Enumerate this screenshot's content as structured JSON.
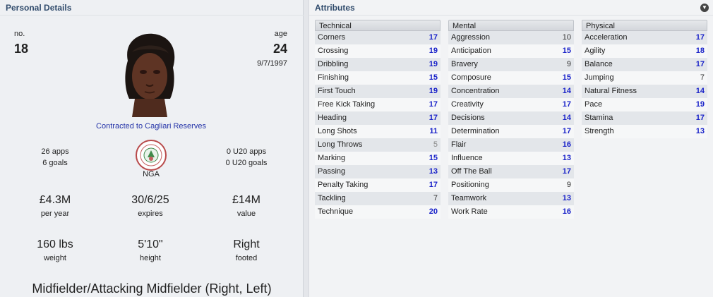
{
  "left": {
    "title": "Personal Details",
    "number_label": "no.",
    "number": "18",
    "age_label": "age",
    "age": "24",
    "dob": "9/7/1997",
    "contract": "Contracted to Cagliari Reserves",
    "apps": "26 apps",
    "goals": "6 goals",
    "u20_apps": "0 U20 apps",
    "u20_goals": "0 U20 goals",
    "nation": "NGA",
    "wage": "£4.3M",
    "wage_label": "per year",
    "expires": "30/6/25",
    "expires_label": "expires",
    "value": "£14M",
    "value_label": "value",
    "weight": "160 lbs",
    "weight_label": "weight",
    "height": "5'10\"",
    "height_label": "height",
    "foot": "Right",
    "foot_label": "footed",
    "position": "Midfielder/Attacking Midfielder (Right, Left)"
  },
  "right": {
    "title": "Attributes",
    "collapse_icon": "chevron-down-circle-icon"
  },
  "colors": {
    "value_blue": "#1a23c9",
    "value_grey": "#333333",
    "value_lightgrey": "#888888",
    "title": "#2f4a6b"
  },
  "technical": {
    "heading": "Technical",
    "rows": [
      {
        "name": "Corners",
        "value": "17"
      },
      {
        "name": "Crossing",
        "value": "19"
      },
      {
        "name": "Dribbling",
        "value": "19"
      },
      {
        "name": "Finishing",
        "value": "15"
      },
      {
        "name": "First Touch",
        "value": "19"
      },
      {
        "name": "Free Kick Taking",
        "value": "17"
      },
      {
        "name": "Heading",
        "value": "17"
      },
      {
        "name": "Long Shots",
        "value": "11"
      },
      {
        "name": "Long Throws",
        "value": "5"
      },
      {
        "name": "Marking",
        "value": "15"
      },
      {
        "name": "Passing",
        "value": "13"
      },
      {
        "name": "Penalty Taking",
        "value": "17"
      },
      {
        "name": "Tackling",
        "value": "7"
      },
      {
        "name": "Technique",
        "value": "20"
      }
    ]
  },
  "mental": {
    "heading": "Mental",
    "rows": [
      {
        "name": "Aggression",
        "value": "10"
      },
      {
        "name": "Anticipation",
        "value": "15"
      },
      {
        "name": "Bravery",
        "value": "9"
      },
      {
        "name": "Composure",
        "value": "15"
      },
      {
        "name": "Concentration",
        "value": "14"
      },
      {
        "name": "Creativity",
        "value": "17"
      },
      {
        "name": "Decisions",
        "value": "14"
      },
      {
        "name": "Determination",
        "value": "17"
      },
      {
        "name": "Flair",
        "value": "16"
      },
      {
        "name": "Influence",
        "value": "13"
      },
      {
        "name": "Off The Ball",
        "value": "17"
      },
      {
        "name": "Positioning",
        "value": "9"
      },
      {
        "name": "Teamwork",
        "value": "13"
      },
      {
        "name": "Work Rate",
        "value": "16"
      }
    ]
  },
  "physical": {
    "heading": "Physical",
    "rows": [
      {
        "name": "Acceleration",
        "value": "17"
      },
      {
        "name": "Agility",
        "value": "18"
      },
      {
        "name": "Balance",
        "value": "17"
      },
      {
        "name": "Jumping",
        "value": "7"
      },
      {
        "name": "Natural Fitness",
        "value": "14"
      },
      {
        "name": "Pace",
        "value": "19"
      },
      {
        "name": "Stamina",
        "value": "17"
      },
      {
        "name": "Strength",
        "value": "13"
      }
    ]
  }
}
